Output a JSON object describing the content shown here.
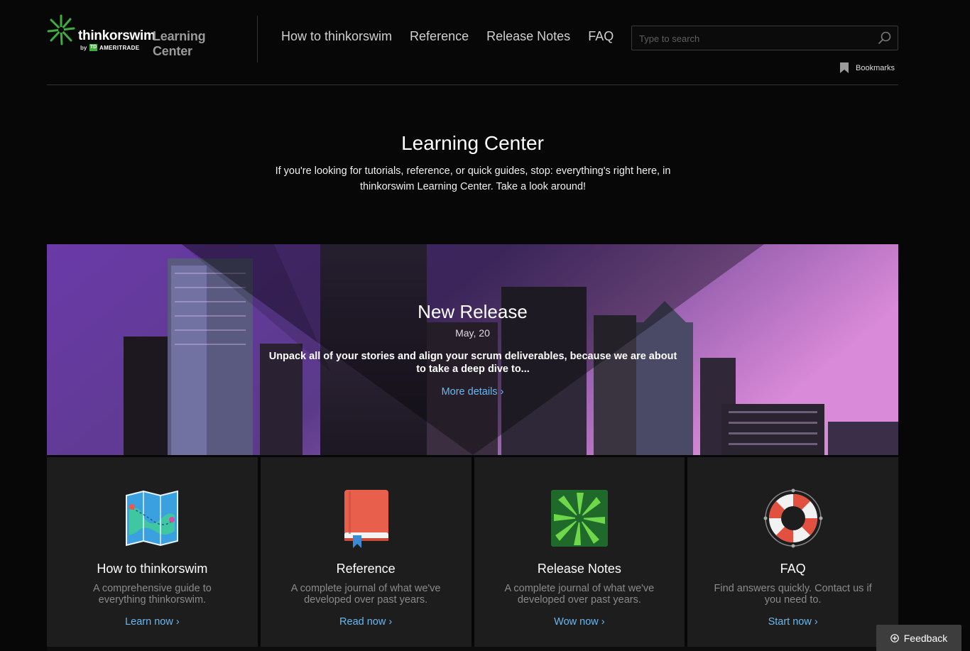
{
  "header": {
    "brand": "thinkorswim",
    "product": "Learning Center",
    "by": "by",
    "td": "TD",
    "ameritrade": "AMERITRADE",
    "nav": [
      {
        "label": "How to thinkorswim"
      },
      {
        "label": "Reference"
      },
      {
        "label": "Release Notes"
      },
      {
        "label": "FAQ"
      }
    ],
    "search": {
      "placeholder": "Type to search",
      "value": ""
    },
    "bookmarks_label": "Bookmarks"
  },
  "intro": {
    "title": "Learning Center",
    "text": "If you're looking for tutorials, reference, or quick guides, stop: everything's right here, in thinkorswim Learning Center. Take a look around!"
  },
  "banner": {
    "title": "New Release",
    "date": "May, 20",
    "text": "Unpack all of your stories and align your scrum deliverables, because we are about to take a deep dive to...",
    "link": "More details ›"
  },
  "cards": [
    {
      "icon": "map-icon",
      "title": "How to thinkorswim",
      "desc": "A comprehensive guide to everything thinkorswim.",
      "link": "Learn now ›"
    },
    {
      "icon": "book-icon",
      "title": "Reference",
      "desc": "A complete journal of what we've developed over past years.",
      "link": "Read now ›"
    },
    {
      "icon": "burst-icon",
      "title": "Release Notes",
      "desc": "A complete journal of what we've developed over past years.",
      "link": "Wow now ›"
    },
    {
      "icon": "lifebuoy-icon",
      "title": "FAQ",
      "desc": "Find answers quickly. Contact us if you need to.",
      "link": "Start now ›"
    }
  ],
  "feedback_label": "Feedback",
  "colors": {
    "accent_link": "#69b7f0",
    "brand_green": "#3fae3f",
    "banner_purple": "#8a55c8"
  }
}
